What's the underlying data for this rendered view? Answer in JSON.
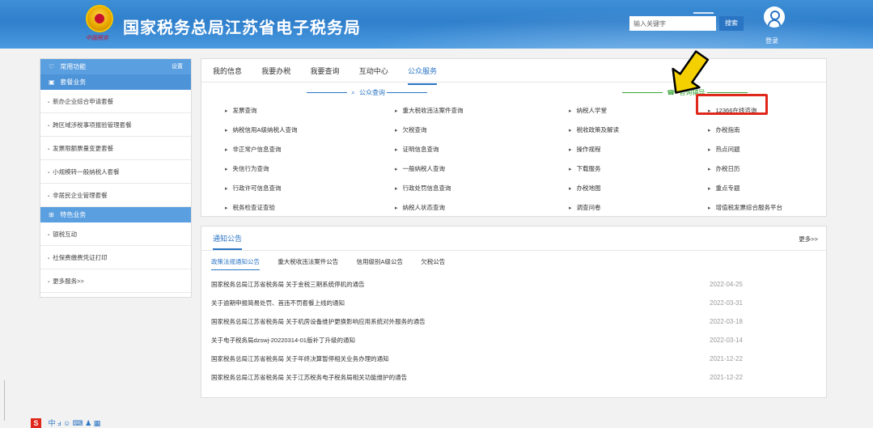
{
  "header": {
    "site_title": "国家税务总局江苏省电子税务局",
    "emblem_text": "中国税务",
    "search_placeholder": "输入关键字",
    "search_button": "搜索",
    "login_label": "登录"
  },
  "sidebar": {
    "common_head": "常用功能",
    "common_settings": "设置",
    "package_head": "套餐业务",
    "package_items": [
      "新办企业综合申请套餐",
      "跨区域涉税事项报验管理套餐",
      "发票限额票量变更套餐",
      "小规模转一般纳税人套餐",
      "非居民企业管理套餐"
    ],
    "special_head": "特色业务",
    "special_items": [
      "银税互动",
      "社保费缴费凭证打印",
      "更多服务>>"
    ]
  },
  "tabs": [
    "我的信息",
    "我要办税",
    "我要查询",
    "互动中心",
    "公众服务"
  ],
  "public_query": {
    "heading": "公众查询",
    "col1": [
      "发票查询",
      "纳税信用A级纳税人查询",
      "非正常户信息查询",
      "失信行为查询",
      "行政许可信息查询",
      "税务检查证查验"
    ],
    "col2": [
      "重大税收违法案件查询",
      "欠税查询",
      "证明信息查询",
      "一般纳税人查询",
      "行政处罚信息查询",
      "纳税人状态查询"
    ]
  },
  "consult": {
    "heading": "咨询辅导",
    "col1": [
      "纳税人学堂",
      "税收政策及解读",
      "操作规程",
      "下载服务",
      "办税地图",
      "调查问卷"
    ],
    "col2": [
      "12366在线咨询",
      "办税指南",
      "热点问题",
      "办税日历",
      "重点专题",
      "增值税发票综合服务平台"
    ]
  },
  "notice": {
    "title": "通知公告",
    "more": "更多>>",
    "subtabs": [
      "政策法规通知公告",
      "重大税收违法案件公告",
      "信用级别A级公告",
      "欠税公告"
    ],
    "items": [
      {
        "title": "国家税务总局江苏省税务局 关于金税三期系统停机的通告",
        "date": "2022-04-25"
      },
      {
        "title": "关于逾期申报简易处罚、首违不罚套餐上线的通知",
        "date": "2022-03-31"
      },
      {
        "title": "国家税务总局江苏省税务局 关于机房设备维护更换影响应用系统对外服务的通告",
        "date": "2022-03-18"
      },
      {
        "title": "关于电子税务局dzswj-20220314-01版补丁升级的通知",
        "date": "2022-03-14"
      },
      {
        "title": "国家税务总局江苏省税务局 关于年终决算暂停相关业务办理的通知",
        "date": "2021-12-22"
      },
      {
        "title": "国家税务总局江苏省税务局 关于江苏税务电子税务局相关功能维护的通告",
        "date": "2021-12-22"
      }
    ]
  },
  "tray": {
    "label": "中",
    "glyphs": "ⅎ ☺ ⌨ ♟ ▦"
  },
  "colors": {
    "brand_blue": "#2a74c4",
    "consult_green": "#3aa537",
    "highlight_red": "#e0271b",
    "arrow_yellow": "#f5d000"
  }
}
